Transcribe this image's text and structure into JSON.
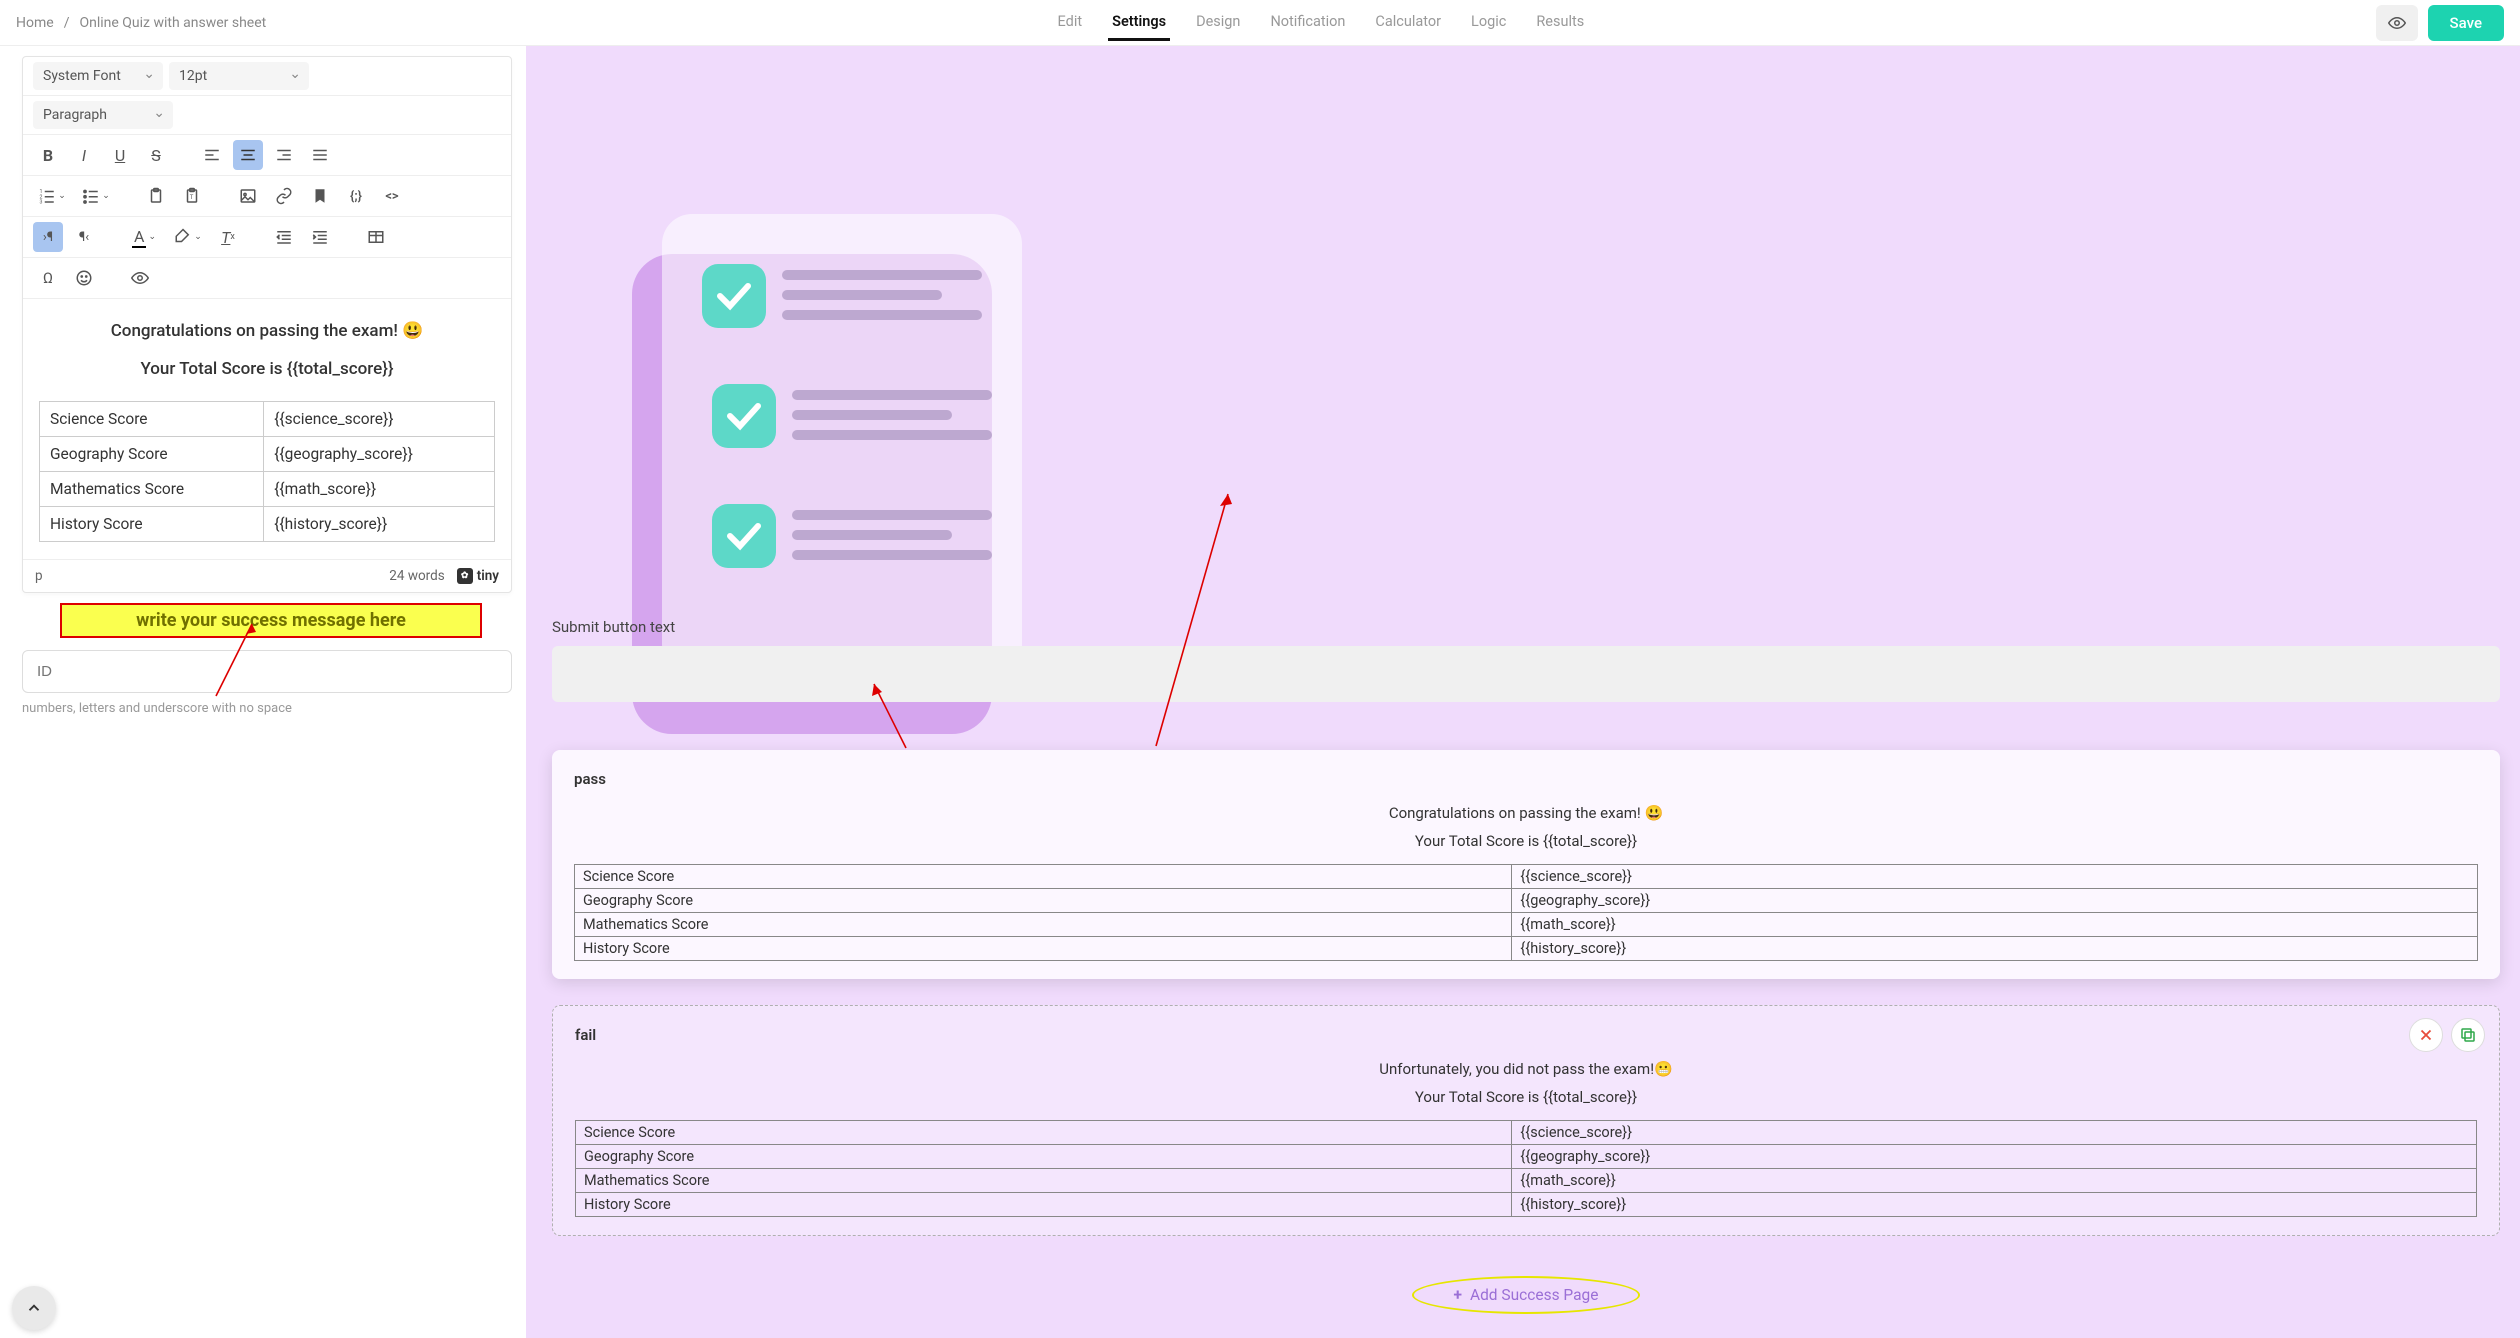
{
  "breadcrumb": {
    "home": "Home",
    "sep": "/",
    "title": "Online Quiz with answer sheet"
  },
  "tabs": {
    "edit": "Edit",
    "settings": "Settings",
    "design": "Design",
    "notification": "Notification",
    "calculator": "Calculator",
    "logic": "Logic",
    "results": "Results"
  },
  "save_label": "Save",
  "editor": {
    "font_family": "System Font",
    "font_size": "12pt",
    "block_format": "Paragraph",
    "line1": "Congratulations on passing the exam! 😃",
    "line2": "Your Total Score is {{total_score}}",
    "footer_path": "p",
    "word_count": "24 words",
    "tiny": "tiny"
  },
  "score_rows": [
    {
      "label": "Science Score",
      "value": "{{science_score}}"
    },
    {
      "label": "Geography Score",
      "value": "{{geography_score}}"
    },
    {
      "label": "Mathematics Score",
      "value": "{{math_score}}"
    },
    {
      "label": "History Score",
      "value": "{{history_score}}"
    }
  ],
  "callout": "write your success message here",
  "id_field": {
    "placeholder": "ID",
    "hint": "numbers, letters and underscore with no space"
  },
  "right": {
    "submit_label": "Submit button text",
    "pass": {
      "title": "pass",
      "msg": "Congratulations on passing the exam! 😃",
      "total": "Your Total Score is {{total_score}}"
    },
    "fail": {
      "title": "fail",
      "msg": "Unfortunately, you did not pass the exam!😬",
      "total": "Your Total Score is {{total_score}}"
    },
    "add_page": "Add Success Page"
  }
}
